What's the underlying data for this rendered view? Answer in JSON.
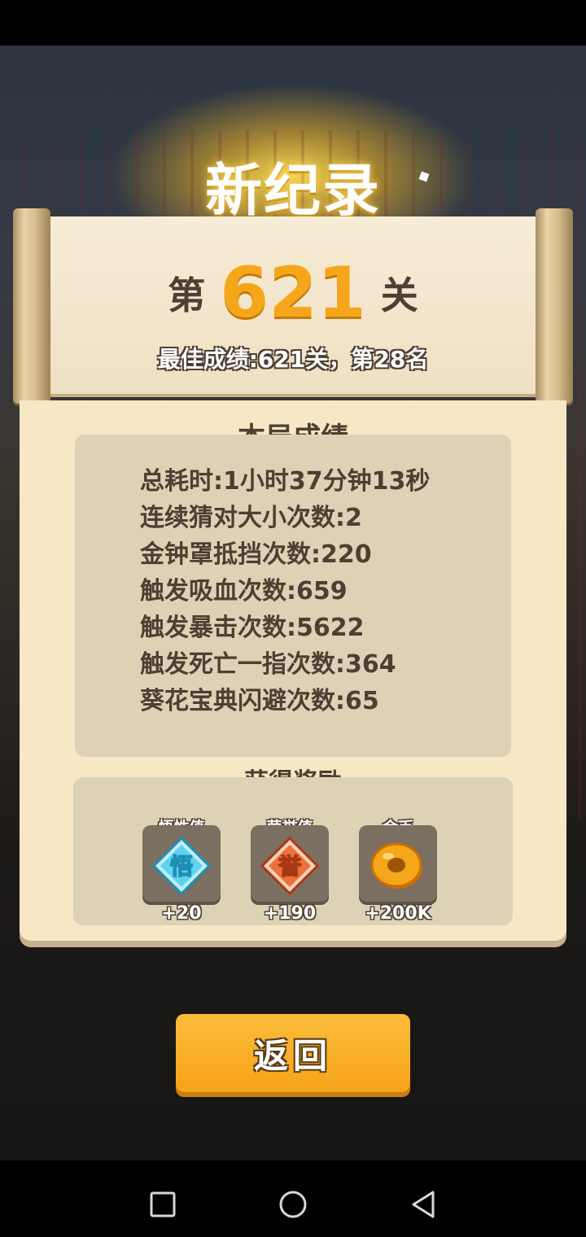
{
  "header": {
    "title": "新纪录"
  },
  "stage": {
    "prefix": "第",
    "number": "621",
    "suffix": "关"
  },
  "best": "最佳成绩:621关，第28名",
  "stats": {
    "title": "本局成绩",
    "lines": [
      "总耗时:1小时37分钟13秒",
      "连续猜对大小次数:2",
      "金钟罩抵挡次数:220",
      "触发吸血次数:659",
      "触发暴击次数:5622",
      "触发死亡一指次数:364",
      "葵花宝典闪避次数:65"
    ]
  },
  "rewards": {
    "title": "获得奖励",
    "items": [
      {
        "label": "悟性值",
        "amount": "+20",
        "icon": "wisdom-gem-icon",
        "glyph": "悟",
        "color": "#5fd3f0"
      },
      {
        "label": "荣誉值",
        "amount": "+190",
        "icon": "honor-gem-icon",
        "glyph": "誉",
        "color": "#f0703c"
      },
      {
        "label": "金币",
        "amount": "+200K",
        "icon": "gold-coin-icon",
        "color": "#f6a61a"
      }
    ]
  },
  "actions": {
    "return_label": "返回"
  },
  "navbar": {
    "recent": "recent-apps-icon",
    "home": "home-icon",
    "back": "back-icon"
  }
}
